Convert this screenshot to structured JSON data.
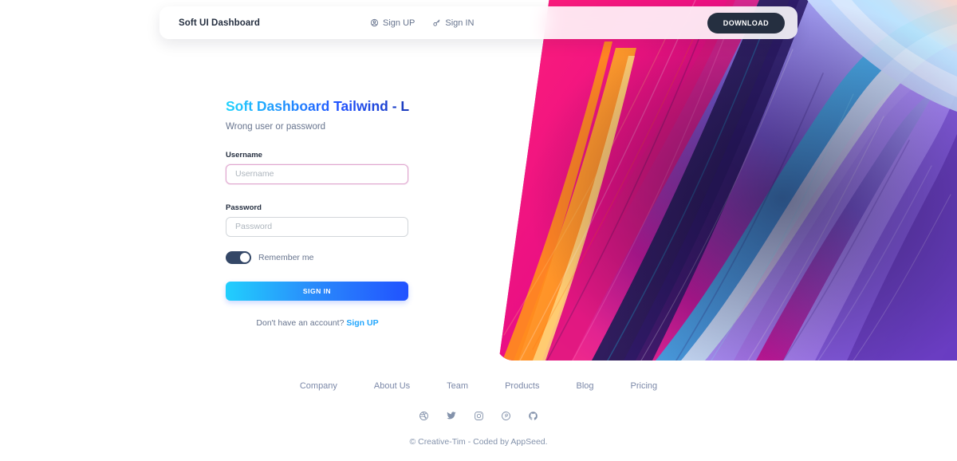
{
  "navbar": {
    "brand": "Soft UI Dashboard",
    "links": [
      {
        "label": "Sign UP",
        "icon": "user-circle-icon"
      },
      {
        "label": "Sign IN",
        "icon": "key-icon"
      }
    ],
    "download_label": "DOWNLOAD"
  },
  "login": {
    "title": "Soft Dashboard Tailwind - Login",
    "subtitle": "Wrong user or password",
    "username_label": "Username",
    "username_placeholder": "Username",
    "username_value": "",
    "password_label": "Password",
    "password_placeholder": "Password",
    "password_value": "",
    "remember_label": "Remember me",
    "remember_on": true,
    "submit_label": "SIGN IN",
    "signup_prompt": "Don't have an account?",
    "signup_link": "Sign UP"
  },
  "footer": {
    "links": [
      {
        "label": "Company"
      },
      {
        "label": "About Us"
      },
      {
        "label": "Team"
      },
      {
        "label": "Products"
      },
      {
        "label": "Blog"
      },
      {
        "label": "Pricing"
      }
    ],
    "socials": [
      {
        "name": "dribbble-icon"
      },
      {
        "name": "twitter-icon"
      },
      {
        "name": "instagram-icon"
      },
      {
        "name": "pinterest-icon"
      },
      {
        "name": "github-icon"
      }
    ],
    "copyright": "© Creative-Tim - Coded by AppSeed."
  },
  "colors": {
    "accent_cyan": "#21d4fd",
    "accent_blue": "#2152ff",
    "dark": "#252f40",
    "muted": "#67748e",
    "focus_border": "#e0a8d0"
  }
}
